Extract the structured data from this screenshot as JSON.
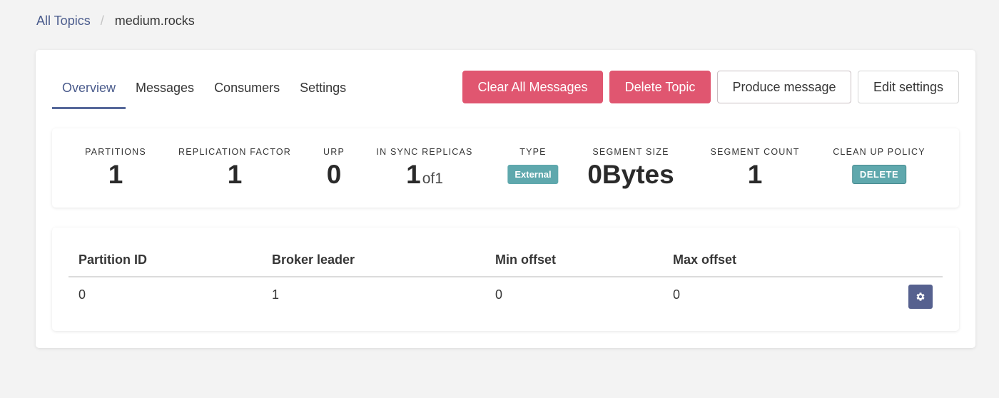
{
  "breadcrumb": {
    "root": "All Topics",
    "separator": "/",
    "current": "medium.rocks"
  },
  "tabs": [
    {
      "label": "Overview",
      "active": true
    },
    {
      "label": "Messages",
      "active": false
    },
    {
      "label": "Consumers",
      "active": false
    },
    {
      "label": "Settings",
      "active": false
    }
  ],
  "actions": {
    "clear_all_messages": "Clear All Messages",
    "delete_topic": "Delete Topic",
    "produce_message": "Produce message",
    "edit_settings": "Edit settings"
  },
  "stats": {
    "partitions": {
      "label": "PARTITIONS",
      "value": "1"
    },
    "replication_factor": {
      "label": "REPLICATION FACTOR",
      "value": "1"
    },
    "urp": {
      "label": "URP",
      "value": "0"
    },
    "in_sync_replicas": {
      "label": "IN SYNC REPLICAS",
      "value": "1",
      "of": "of1"
    },
    "type": {
      "label": "TYPE",
      "value": "External"
    },
    "segment_size": {
      "label": "SEGMENT SIZE",
      "value": "0Bytes"
    },
    "segment_count": {
      "label": "SEGMENT COUNT",
      "value": "1"
    },
    "clean_up_policy": {
      "label": "CLEAN UP POLICY",
      "value": "DELETE"
    }
  },
  "table": {
    "columns": [
      "Partition ID",
      "Broker leader",
      "Min offset",
      "Max offset"
    ],
    "rows": [
      [
        "0",
        "1",
        "0",
        "0"
      ]
    ],
    "row_action_icon": "gear-icon"
  },
  "colors": {
    "danger": "#e05670",
    "accent": "#4a5b8c",
    "tag": "#5fa8ad",
    "gear_button": "#56618f"
  }
}
